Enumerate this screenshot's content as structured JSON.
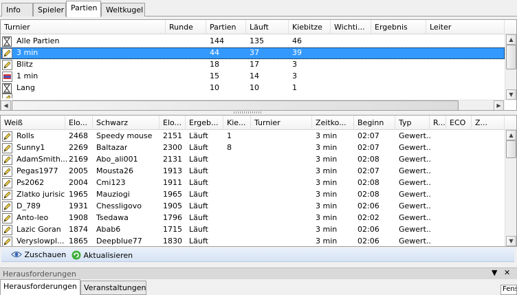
{
  "tabs": [
    {
      "label": "Info",
      "active": false
    },
    {
      "label": "Spieler",
      "active": false
    },
    {
      "label": "Partien",
      "active": true
    },
    {
      "label": "Weltkugel",
      "active": false
    }
  ],
  "tournaments": {
    "columns": [
      "Turnier",
      "Runde",
      "Partien",
      "Läuft",
      "Kiebitze",
      "Wichti...",
      "Ergebnis",
      "Leiter"
    ],
    "rows": [
      {
        "icon": "hourglass-icon",
        "name": "Alle Partien",
        "runde": "",
        "partien": "144",
        "laeuft": "135",
        "kiebitze": "46",
        "selected": false
      },
      {
        "icon": "pencil-icon",
        "name": "3 min",
        "runde": "",
        "partien": "44",
        "laeuft": "37",
        "kiebitze": "39",
        "selected": true
      },
      {
        "icon": "pencil-icon",
        "name": "Blitz",
        "runde": "",
        "partien": "18",
        "laeuft": "17",
        "kiebitze": "3",
        "selected": false
      },
      {
        "icon": "flag-icon",
        "name": "1 min",
        "runde": "",
        "partien": "15",
        "laeuft": "14",
        "kiebitze": "3",
        "selected": false
      },
      {
        "icon": "hourglass-icon",
        "name": "Lang",
        "runde": "",
        "partien": "10",
        "laeuft": "10",
        "kiebitze": "1",
        "selected": false
      }
    ]
  },
  "games": {
    "columns": [
      "Weiß",
      "Elo...",
      "Schwarz",
      "Elo...",
      "Ergeb...",
      "Kie...",
      "Turnier",
      "Zeitko...",
      "Beginn",
      "Typ",
      "R...",
      "ECO",
      "Z..."
    ],
    "rows": [
      {
        "white": "Rolls",
        "elo_w": "2468",
        "black": "Speedy mouse",
        "elo_b": "2151",
        "result": "Läuft",
        "kib": "1",
        "time": "3 min",
        "start": "02:07",
        "type": "Gewert.."
      },
      {
        "white": "Sunny1",
        "elo_w": "2269",
        "black": "Baltazar",
        "elo_b": "2300",
        "result": "Läuft",
        "kib": "8",
        "time": "3 min",
        "start": "02:07",
        "type": "Gewert.."
      },
      {
        "white": "AdamSmith...",
        "elo_w": "2169",
        "black": "Abo_ali001",
        "elo_b": "2131",
        "result": "Läuft",
        "kib": "",
        "time": "3 min",
        "start": "02:08",
        "type": "Gewert.."
      },
      {
        "white": "Pegas1977",
        "elo_w": "2005",
        "black": "Mousta26",
        "elo_b": "1913",
        "result": "Läuft",
        "kib": "",
        "time": "3 min",
        "start": "02:07",
        "type": "Gewert.."
      },
      {
        "white": "Ps2062",
        "elo_w": "2004",
        "black": "Cmi123",
        "elo_b": "1911",
        "result": "Läuft",
        "kib": "",
        "time": "3 min",
        "start": "02:08",
        "type": "Gewert.."
      },
      {
        "white": "Zlatko jurisic",
        "elo_w": "1965",
        "black": "Mauziogi",
        "elo_b": "1965",
        "result": "Läuft",
        "kib": "",
        "time": "3 min",
        "start": "02:08",
        "type": "Gewert.."
      },
      {
        "white": "D_789",
        "elo_w": "1931",
        "black": "Chessligovo",
        "elo_b": "1905",
        "result": "Läuft",
        "kib": "",
        "time": "3 min",
        "start": "02:06",
        "type": "Gewert.."
      },
      {
        "white": "Anto-leo",
        "elo_w": "1908",
        "black": "Tsedawa",
        "elo_b": "1796",
        "result": "Läuft",
        "kib": "",
        "time": "3 min",
        "start": "02:02",
        "type": "Gewert.."
      },
      {
        "white": "Lazic Goran",
        "elo_w": "1874",
        "black": "Abab6",
        "elo_b": "1715",
        "result": "Läuft",
        "kib": "",
        "time": "3 min",
        "start": "02:06",
        "type": "Gewert.."
      },
      {
        "white": "Veryslowpl...",
        "elo_w": "1865",
        "black": "Deepblue77",
        "elo_b": "1830",
        "result": "Läuft",
        "kib": "",
        "time": "3 min",
        "start": "02:06",
        "type": "Gewert.."
      }
    ]
  },
  "toolbar": {
    "watch_label": "Zuschauen",
    "refresh_label": "Aktualisieren"
  },
  "dock": {
    "title": "Herausforderungen",
    "tabs": [
      {
        "label": "Herausforderungen",
        "active": true
      },
      {
        "label": "Veranstaltungen",
        "active": false
      }
    ],
    "corner_label": "Fens"
  },
  "colors": {
    "selection": "#3399ff",
    "toolbar": "#dce7f6"
  }
}
